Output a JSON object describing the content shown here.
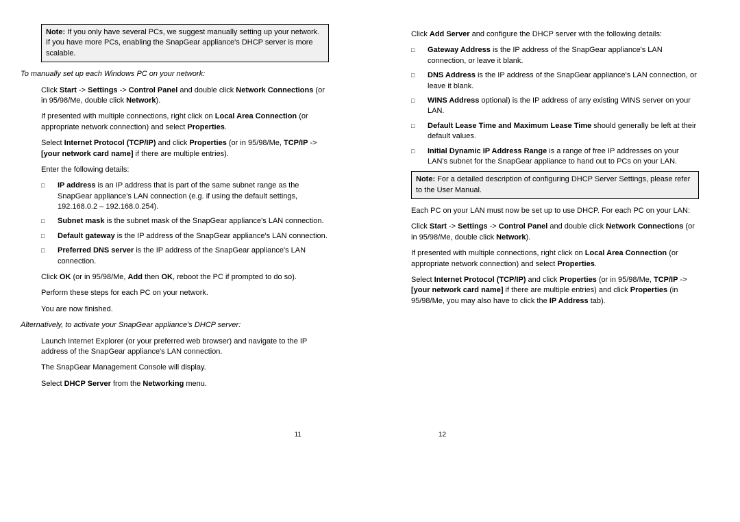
{
  "left": {
    "note": {
      "label": "Note:",
      "text": " If you only have several PCs, we suggest manually setting up your network. If you have more PCs, enabling the SnapGear appliance's DHCP server is more scalable."
    },
    "heading1": "To manually set up each Windows PC on your network:",
    "p1a": "Click ",
    "p1b": "Start",
    "p1c": " -> ",
    "p1d": "Settings",
    "p1e": " -> ",
    "p1f": "Control Panel",
    "p1g": " and double click ",
    "p1h": "Network Connections",
    "p1i": " (or in 95/98/Me, double click ",
    "p1j": "Network",
    "p1k": ").",
    "p2a": "If presented with multiple connections, right click on ",
    "p2b": "Local Area Connection",
    "p2c": " (or appropriate network connection) and select ",
    "p2d": "Properties",
    "p2e": ".",
    "p3a": "Select ",
    "p3b": "Internet Protocol (TCP/IP)",
    "p3c": " and click ",
    "p3d": "Properties",
    "p3e": " (or in 95/98/Me, ",
    "p3f": "TCP/IP",
    "p3g": " -> ",
    "p3h": "[your network card name]",
    "p3i": " if there are multiple entries).",
    "p4": "Enter the following details:",
    "b1a": "IP address",
    "b1b": " is an IP address that is part of the same subnet range as the SnapGear appliance's LAN connection (e.g. if using the default settings, 192.168.0.2 – 192.168.0.254).",
    "b2a": "Subnet mask",
    "b2b": " is the subnet mask of the SnapGear appliance's LAN connection.",
    "b3a": "Default gateway",
    "b3b": " is the IP address of the SnapGear appliance's LAN connection.",
    "b4a": "Preferred DNS server",
    "b4b": " is the IP address of the SnapGear appliance's LAN connection.",
    "p5a": "Click ",
    "p5b": "OK",
    "p5c": " (or in 95/98/Me, ",
    "p5d": "Add",
    "p5e": " then ",
    "p5f": "OK",
    "p5g": ", reboot the PC if prompted to do so).",
    "p6": "Perform these steps for each PC on your network.",
    "p7": "You are now finished.",
    "heading2": "Alternatively, to activate your SnapGear appliance's DHCP server:",
    "p8": "Launch Internet Explorer (or your preferred web browser) and navigate to the IP address of the SnapGear appliance's LAN connection.",
    "p9": "The SnapGear Management Console will display.",
    "p10a": "Select ",
    "p10b": "DHCP Server",
    "p10c": " from the ",
    "p10d": "Networking",
    "p10e": " menu.",
    "pageNum": "11"
  },
  "right": {
    "p1a": "Click ",
    "p1b": "Add Server",
    "p1c": " and configure the DHCP server with the following details:",
    "b1a": "Gateway Address",
    "b1b": " is the IP address of the SnapGear appliance's LAN connection, or leave it blank.",
    "b2a": "DNS Address",
    "b2b": " is the IP address of the SnapGear appliance's LAN connection, or leave it blank.",
    "b3a": "WINS Address",
    "b3b": " optional) is the IP address of any existing WINS server on your LAN.",
    "b4a": "Default Lease Time and Maximum Lease Time",
    "b4b": " should generally be left at their default values.",
    "b5a": "Initial Dynamic IP Address Range",
    "b5b": " is a range of free IP addresses on your LAN's subnet for the SnapGear appliance to hand out to PCs on your LAN.",
    "note": {
      "label": "Note:",
      "text": " For a detailed description of configuring DHCP Server Settings, please refer to the User Manual."
    },
    "p2": "Each PC on your LAN must now be set up to use DHCP. For each PC on your LAN:",
    "p3a": "Click ",
    "p3b": "Start",
    "p3c": " -> ",
    "p3d": "Settings",
    "p3e": " -> ",
    "p3f": "Control Panel",
    "p3g": " and double click ",
    "p3h": "Network Connections",
    "p3i": " (or in 95/98/Me, double click ",
    "p3j": "Network",
    "p3k": ").",
    "p4a": "If presented with multiple connections, right click on ",
    "p4b": "Local Area Connection",
    "p4c": " (or appropriate network connection) and select ",
    "p4d": "Properties",
    "p4e": ".",
    "p5a": "Select ",
    "p5b": "Internet Protocol (TCP/IP)",
    "p5c": " and click ",
    "p5d": "Properties",
    "p5e": " (or in 95/98/Me, ",
    "p5f": "TCP/IP",
    "p5g": " -> ",
    "p5h": "[your network card name]",
    "p5i": " if there are multiple entries) and click ",
    "p5j": "Properties",
    "p5k": " (in 95/98/Me, you may also have to click the ",
    "p5l": "IP Address",
    "p5m": " tab).",
    "pageNum": "12"
  }
}
